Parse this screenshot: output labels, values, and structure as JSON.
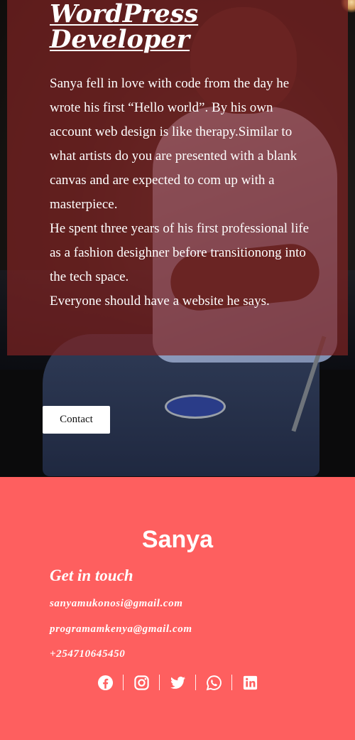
{
  "hero": {
    "title": "WordPress Developer",
    "bio_lines": [
      "Sanya fell in love with code from the day he wrote his first “Hello world”. By his own account web design is like therapy.Similar to what artists do you are presented with a blank canvas and are expected to com up with a masterpiece.",
      "He spent three years of his first professional life as a fashion desighner before transitionong into the tech space.",
      "Everyone should have a website he says."
    ],
    "contact_button": "Contact"
  },
  "footer": {
    "brand": "Sanya",
    "heading": "Get in touch",
    "contacts": [
      "sanyamukonosi@gmail.com",
      "programamkenya@gmail.com",
      "+254710645450"
    ],
    "social_icons": [
      "facebook-icon",
      "instagram-icon",
      "twitter-icon",
      "whatsapp-icon",
      "linkedin-icon"
    ],
    "colors": {
      "footer_bg": "#fe5f5f",
      "overlay": "#7d2222",
      "text": "#ffffff"
    }
  }
}
